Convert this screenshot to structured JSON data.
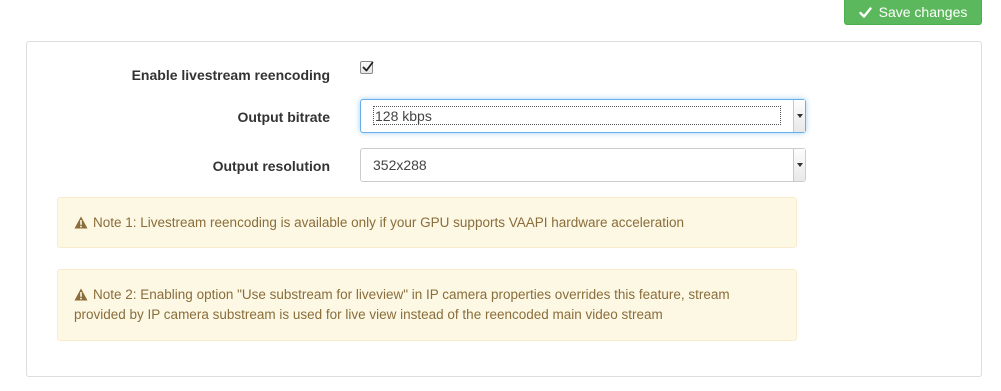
{
  "toolbar": {
    "save_label": "Save changes"
  },
  "form": {
    "reencoding": {
      "label": "Enable livestream reencoding",
      "checked": true
    },
    "bitrate": {
      "label": "Output bitrate",
      "value": "128 kbps"
    },
    "resolution": {
      "label": "Output resolution",
      "value": "352x288"
    }
  },
  "notes": [
    {
      "icon": "warning-icon",
      "text": "Note 1: Livestream reencoding is available only if your GPU supports VAAPI hardware acceleration"
    },
    {
      "icon": "warning-icon",
      "text": "Note 2: Enabling option \"Use substream for liveview\" in IP camera properties overrides this feature, stream provided by IP camera substream is used for live view instead of the reencoded main video stream"
    }
  ],
  "colors": {
    "save_button": "#5cb85c",
    "note_background": "#fcf8e3",
    "note_text": "#8a6d3b",
    "focus_border": "#66afe9"
  }
}
